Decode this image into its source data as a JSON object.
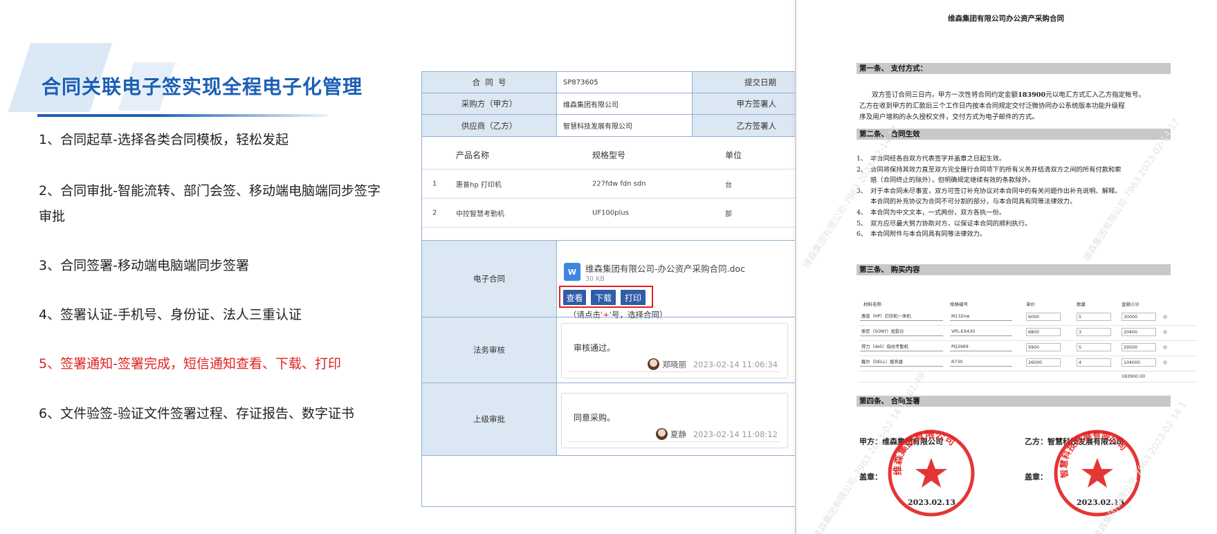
{
  "slide": {
    "title": "合同关联电子签实现全程电子化管理",
    "features": [
      "1、合同起草-选择各类合同模板，轻松发起",
      "2、合同审批-智能流转、部门会签、移动端电脑端同步签字审批",
      "3、合同签署-移动端电脑端同步签署",
      "4、签署认证-手机号、身份证、法人三重认证",
      "5、签署通知-签署完成，短信通知查看、下载、打印",
      "6、文件验签-验证文件签署过程、存证报告、数字证书"
    ],
    "highlight_color": "#e1201f",
    "title_color": "#1b5fb5"
  },
  "form": {
    "contract_no_label": "合  同  号",
    "contract_no": "SP873605",
    "submit_date_label": "提交日期",
    "buyer_label": "采购方（甲方）",
    "buyer": "维森集团有限公司",
    "buyer_signer_label": "甲方签署人",
    "supplier_label": "供应商（乙方）",
    "supplier": "智慧科技发展有限公司",
    "supplier_signer_label": "乙方签署人",
    "products": {
      "headers": [
        "产品名称",
        "规格型号",
        "单位"
      ],
      "rows": [
        {
          "no": "1",
          "name": "惠普hp 打印机",
          "model": "227fdw fdn sdn",
          "unit": "台"
        },
        {
          "no": "2",
          "name": "中控智慧考勤机",
          "model": "UF100plus",
          "unit": "部"
        }
      ]
    },
    "econtract_label": "电子合同",
    "file": {
      "icon": "W",
      "name": "维森集团有限公司-办公资产采购合同.doc",
      "size": "30 KB"
    },
    "buttons": {
      "view": "查看",
      "download": "下载",
      "print": "打印"
    },
    "hint_pre": "（请点击",
    "hint_plus": "'+'",
    "hint_post": "号，选择合同）",
    "legal_label": "法务审核",
    "legal": {
      "text": "审核通过。",
      "name": "郑晓丽",
      "time": "2023-02-14 11:06:34"
    },
    "superior_label": "上级审批",
    "superior": {
      "text": "同意采购。",
      "name": "夏静",
      "time": "2023-02-14 11:08:12"
    }
  },
  "doc": {
    "title": "维森集团有限公司办公资产采购合同",
    "sec1": "第一条、    支付方式：",
    "p1_a": "双方签订合同三日内，甲方一次性将合同约定金额",
    "p1_amount": "183900",
    "p1_b": "元以电汇方式汇入乙方指定帐号。",
    "p1_line2": "乙方在收到甲方的汇款后三个工作日内按本合同规定交付泛微协同办公系统版本功能升级程",
    "p1_line3": "序及用户增购的永久授权文件，交付方式为电子邮件的方式。",
    "sec2": "第二条、    合同生效",
    "clauses": [
      {
        "n": "1、",
        "t": "本合同经各自双方代表签字并盖章之日起生效。"
      },
      {
        "n": "2、",
        "t": "合同将保持其效力直至双方完全履行合同项下的所有义务并结清双方之间的所有付款和索"
      },
      {
        "n": "",
        "t": "赔（合同终止的除外），但明确规定继续有效的条款除外。"
      },
      {
        "n": "3、",
        "t": "对于本合同未尽事宜，双方可签订补充协议对本合同中的有关问题作出补充说明、解释。"
      },
      {
        "n": "",
        "t": "本合同的补充协议为合同不可分割的部分，与本合同具有同等法律效力。"
      },
      {
        "n": "4、",
        "t": "本合同为中文文本，一式两份，双方各执一份。"
      },
      {
        "n": "5、",
        "t": "双方应尽最大努力协助对方，以保证本合同的顺利执行。"
      },
      {
        "n": "6、",
        "t": "本合同附件与本合同具有同等法律效力。"
      }
    ],
    "sec3": "第三条、    购买内容",
    "purchase": {
      "headers": [
        "材料名称",
        "规格编号",
        "单价",
        "数量",
        "金额小计"
      ],
      "rows": [
        [
          "惠普（HP）打印机一体机",
          "M132nw",
          "6000",
          "5",
          "30000"
        ],
        [
          "索尼（SONY）投影仪",
          "VPL-EX430",
          "6800",
          "3",
          "20400"
        ],
        [
          "得力（deli）指纹考勤机",
          "PQ3969",
          "5900",
          "5",
          "29500"
        ],
        [
          "戴尔（DELL）服务器",
          "R730",
          "26000",
          "4",
          "104000"
        ]
      ],
      "total": "183900.00"
    },
    "sec4": "第四条、    合同签署",
    "party_a": "甲方：维森集团有限公司",
    "party_b": "乙方：智慧科技发展有限公司",
    "seal_label": "盖章：",
    "seal_a_text": "维森集团有限公司",
    "seal_b_text": "智慧科技发展有限公司",
    "date_a": "2023.02.13",
    "date_b": "2023.02.13",
    "watermarks": [
      "维森集团有限公司-7963 2023-02-14 17",
      "维森集团有限公司-7963 2023-02-14 17:01:49",
      "维森集团有限公司-7963 2023-02-14 1"
    ],
    "seal_color": "#e1201f"
  }
}
